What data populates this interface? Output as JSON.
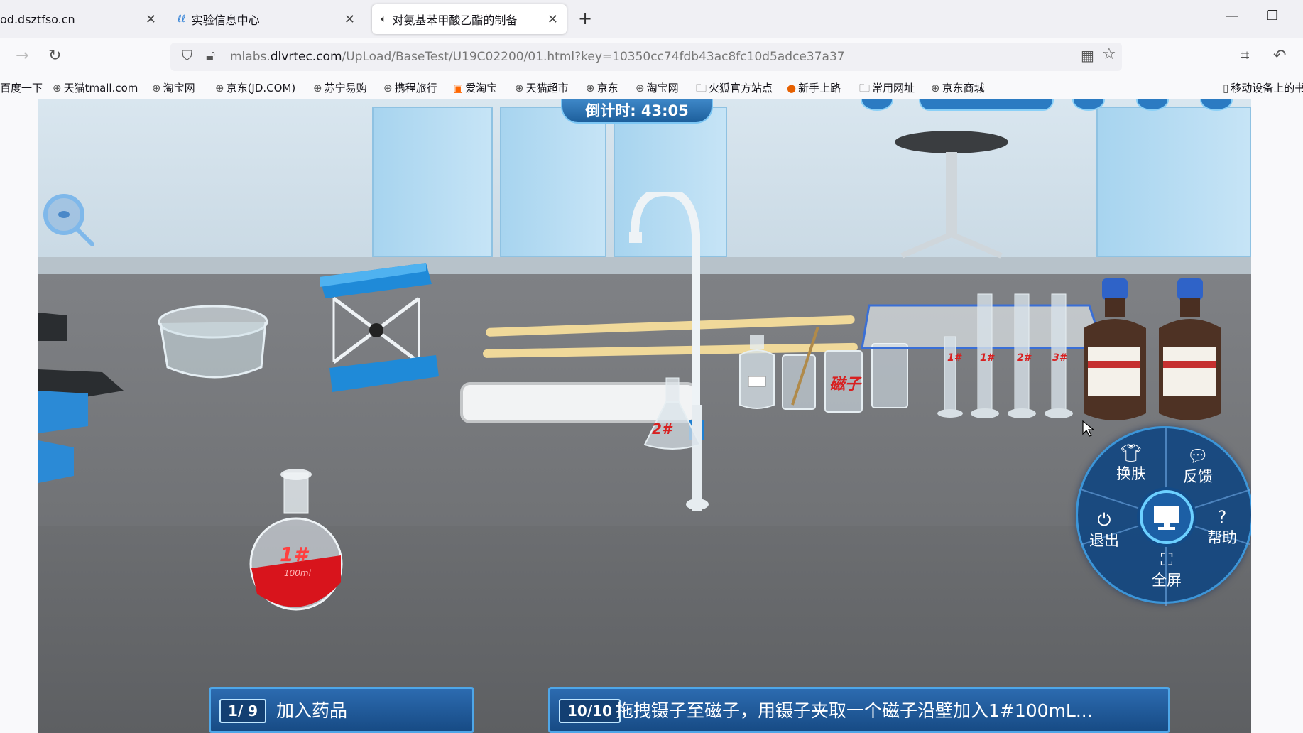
{
  "browser": {
    "tabs": [
      {
        "title": "od.dsztfso.cn",
        "active": false
      },
      {
        "title": "实验信息中心",
        "active": false
      },
      {
        "title": "对氨基苯甲酸乙酯的制备",
        "active": true
      }
    ],
    "url": {
      "prefix": "mlabs.",
      "domain": "dlvrtec.com",
      "path": "/UpLoad/BaseTest/U19C02200/01.html?key=10350cc74fdb43ac8fc10d5adce37a37"
    },
    "bookmarks": [
      "百度一下",
      "天猫tmall.com",
      "淘宝网",
      "京东(JD.COM)",
      "苏宁易购",
      "携程旅行",
      "爱淘宝",
      "天猫超市",
      "京东",
      "淘宝网",
      "火狐官方站点",
      "新手上路",
      "常用网址",
      "京东商城",
      "移动设备上的书签"
    ]
  },
  "scene": {
    "timer": "倒计时: 43:05",
    "labels": {
      "flask1": "1#",
      "flask1_volume": "100ml",
      "flask2": "2#",
      "stir_bar": "磁子",
      "cylinder1": "1#",
      "cylinder2": "1#",
      "cylinder3": "2#",
      "cylinder4": "3#"
    }
  },
  "menu": {
    "skin": "换肤",
    "feedback": "反馈",
    "exit": "退出",
    "help": "帮助",
    "fullscreen": "全屏"
  },
  "steps": {
    "left_num": "1/ 9",
    "left_text": "加入药品",
    "right_num": "10/10",
    "right_text": "拖拽镊子至磁子，用镊子夹取一个磁子沿壁加入1#100mL..."
  }
}
